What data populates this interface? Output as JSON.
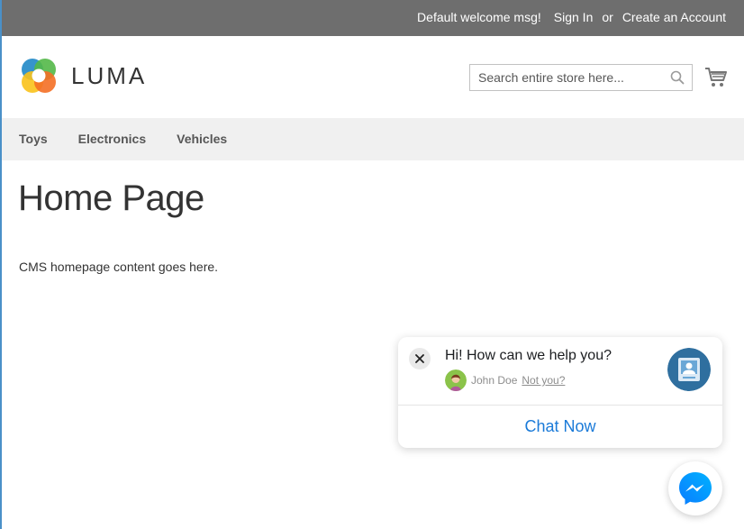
{
  "topbar": {
    "welcome": "Default welcome msg!",
    "sign_in": "Sign In",
    "or": "or",
    "create_account": "Create an Account"
  },
  "header": {
    "logo_text": "LUMA",
    "search_placeholder": "Search entire store here...",
    "icons": {
      "search": "search-icon",
      "cart": "cart-icon"
    }
  },
  "nav": {
    "items": [
      {
        "label": "Toys"
      },
      {
        "label": "Electronics"
      },
      {
        "label": "Vehicles"
      }
    ]
  },
  "main": {
    "title": "Home Page",
    "body": "CMS homepage content goes here."
  },
  "chat": {
    "greeting": "Hi! How can we help you?",
    "user_name": "John Doe",
    "not_you": "Not you?",
    "cta": "Chat Now",
    "accent": "#1a7ad8"
  },
  "colors": {
    "topbar_bg": "#6e6e6e",
    "nav_bg": "#f0f0f0",
    "logo": [
      "#f46f25",
      "#53b848",
      "#2b8ec9",
      "#f9c21b"
    ]
  }
}
